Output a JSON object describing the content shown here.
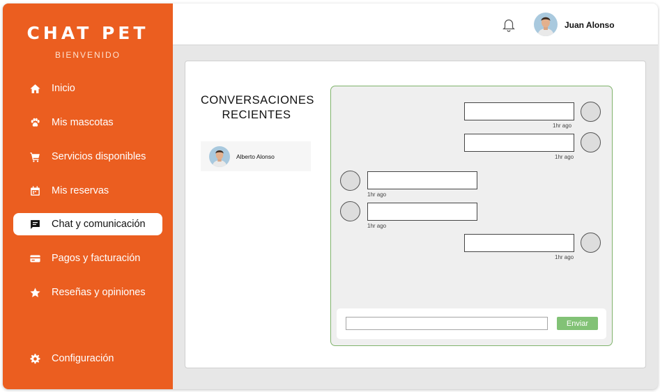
{
  "app": {
    "brand": "CHAT PET",
    "subtitle": "BIENVENIDO"
  },
  "sidebar": {
    "items": [
      {
        "label": "Inicio",
        "icon": "home-icon"
      },
      {
        "label": "Mis mascotas",
        "icon": "paw-icon"
      },
      {
        "label": "Servicios disponibles",
        "icon": "cart-icon"
      },
      {
        "label": "Mis reservas",
        "icon": "calendar-icon"
      },
      {
        "label": "Chat y comunicación",
        "icon": "chat-icon",
        "active": true
      },
      {
        "label": "Pagos y facturación",
        "icon": "credit-card-icon"
      },
      {
        "label": "Reseñas y opiniones",
        "icon": "star-icon"
      },
      {
        "label": "Configuración",
        "icon": "gear-icon"
      }
    ]
  },
  "header": {
    "user_name": "Juan Alonso",
    "notification_icon": "bell-icon"
  },
  "conversations": {
    "title_line1": "CONVERSACIONES",
    "title_line2": "RECIENTES",
    "items": [
      {
        "name": "Alberto Alonso"
      }
    ]
  },
  "chat": {
    "messages": [
      {
        "side": "right",
        "time": "1hr ago"
      },
      {
        "side": "right",
        "time": "1hr ago"
      },
      {
        "side": "left",
        "time": "1hr ago"
      },
      {
        "side": "left",
        "time": "1hr ago"
      },
      {
        "side": "right",
        "time": "1hr ago"
      }
    ],
    "input_value": "",
    "send_label": "Enviar"
  },
  "colors": {
    "sidebar": "#eb5e20",
    "send_button": "#82c276",
    "chat_border": "#7fb36a"
  }
}
